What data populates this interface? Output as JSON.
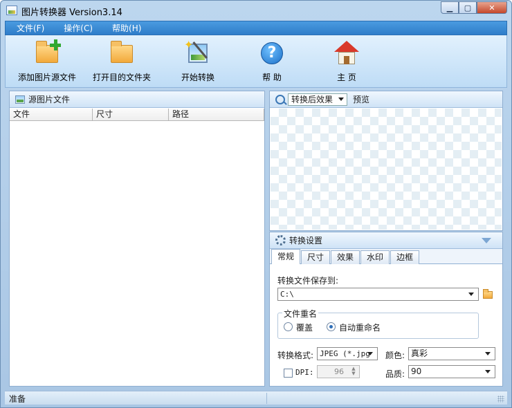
{
  "window": {
    "title": "图片转换器 Version3.14",
    "minimize_glyph": "▁",
    "maximize_glyph": "▢",
    "close_glyph": "✕"
  },
  "menu": {
    "items": [
      "文件(F)",
      "操作(C)",
      "帮助(H)"
    ]
  },
  "toolbar": {
    "add_source": "添加图片源文件",
    "open_target": "打开目的文件夹",
    "start_convert": "开始转换",
    "help": "帮 助",
    "home": "主 页"
  },
  "icons": {
    "add_source": "folder-add-icon",
    "open_target": "folder-open-icon",
    "start_convert": "magic-wand-picture-icon",
    "help": "help-icon",
    "home": "home-icon"
  },
  "source_panel": {
    "title": "源图片文件",
    "columns": [
      "文件",
      "尺寸",
      "路径"
    ]
  },
  "preview_panel": {
    "mode_selected": "转换后效果",
    "preview_label": "预览"
  },
  "settings_panel": {
    "title": "转换设置",
    "tabs": [
      "常规",
      "尺寸",
      "效果",
      "水印",
      "边框"
    ],
    "active_tab": "常规",
    "save_to_label": "转换文件保存到:",
    "save_to_value": "C:\\",
    "rename_group_title": "文件重名",
    "rename_overwrite": "覆盖",
    "rename_auto": "自动重命名",
    "rename_selected": "自动重命名",
    "format_label": "转换格式:",
    "format_value": "JPEG (*.jpg",
    "color_label": "颜色:",
    "color_value": "真彩",
    "dpi_label": "DPI:",
    "dpi_value": "96",
    "dpi_checked": false,
    "quality_label": "品质:",
    "quality_value": "90"
  },
  "status": {
    "text": "准备"
  },
  "colors": {
    "menubar": "#2f7dc9",
    "toolbar": "#cfe6f9",
    "frame": "#b2cdeb"
  }
}
